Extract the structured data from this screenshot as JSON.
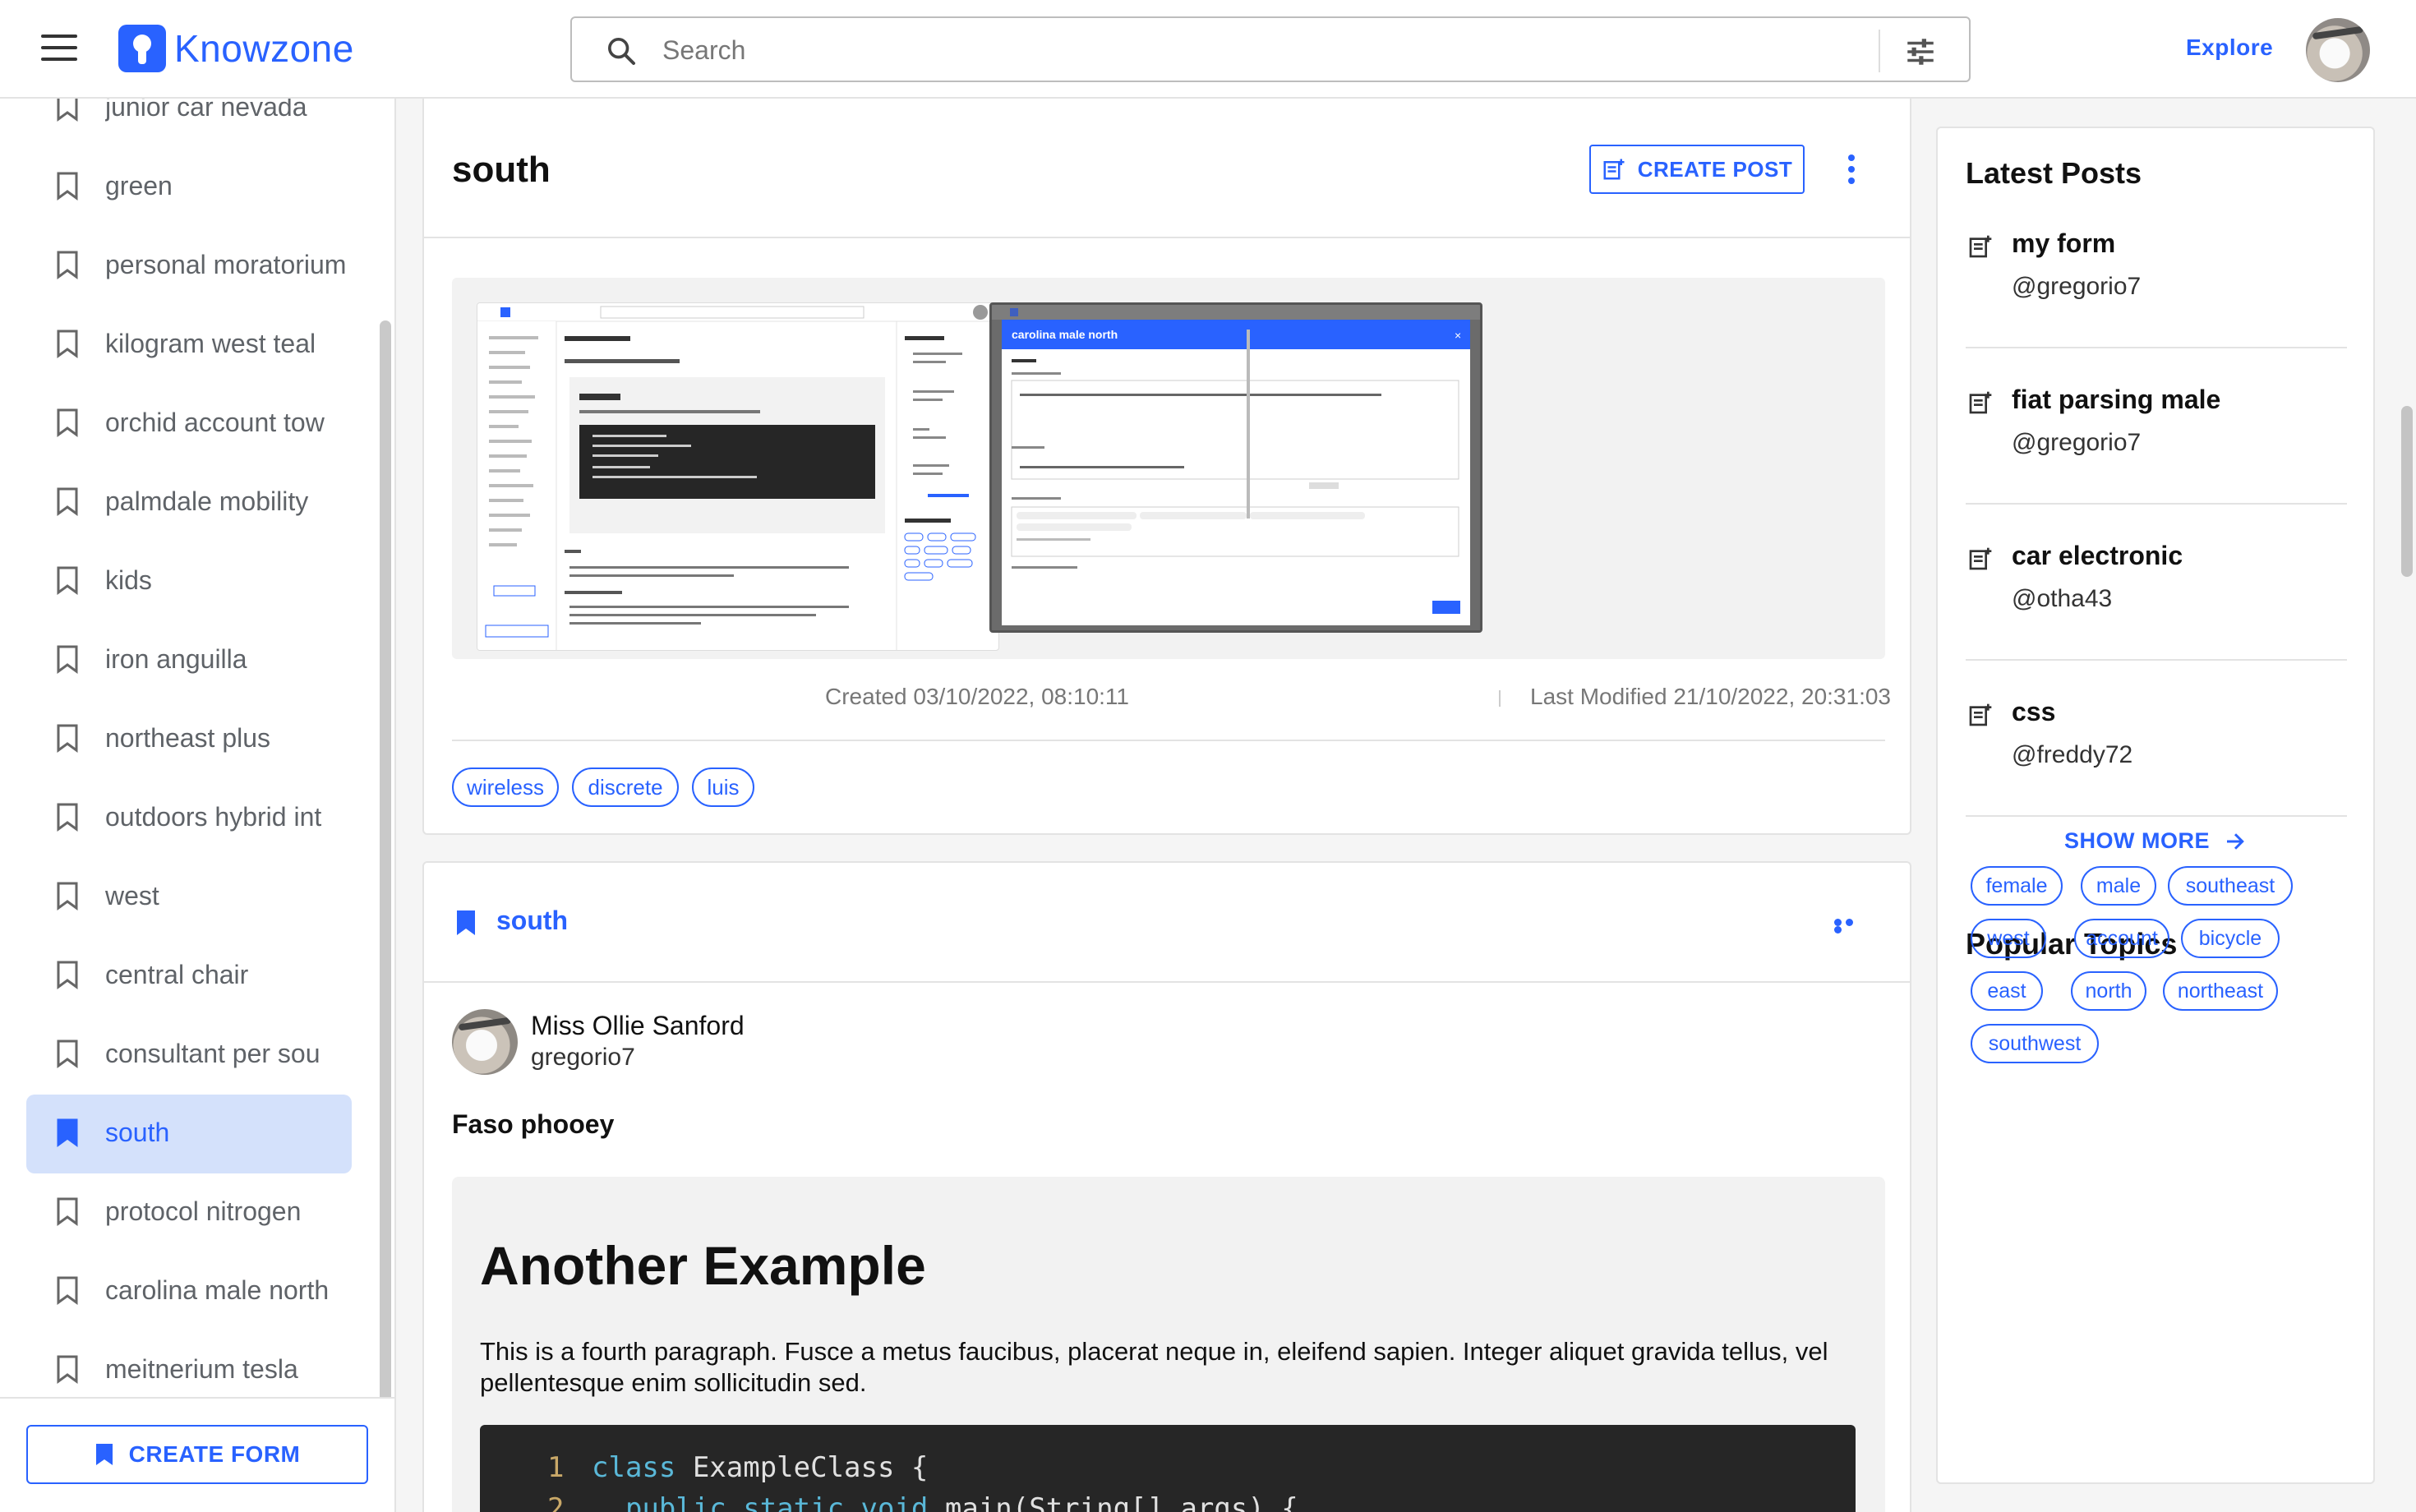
{
  "app": {
    "name": "Knowzone"
  },
  "search": {
    "placeholder": "Search"
  },
  "header": {
    "explore_label": "Explore"
  },
  "sidebar": {
    "items": [
      {
        "label": "junior car nevada"
      },
      {
        "label": "green"
      },
      {
        "label": "personal moratorium"
      },
      {
        "label": "kilogram west teal"
      },
      {
        "label": "orchid account tow"
      },
      {
        "label": "palmdale mobility"
      },
      {
        "label": "kids"
      },
      {
        "label": "iron anguilla"
      },
      {
        "label": "northeast plus"
      },
      {
        "label": "outdoors hybrid int"
      },
      {
        "label": "west"
      },
      {
        "label": "central chair"
      },
      {
        "label": "consultant per sou"
      },
      {
        "label": "south",
        "active": true
      },
      {
        "label": "protocol nitrogen"
      },
      {
        "label": "carolina male north"
      },
      {
        "label": "meitnerium tesla"
      }
    ],
    "create_form_label": "CREATE FORM"
  },
  "topic_card": {
    "title": "south",
    "create_post_label": "CREATE POST",
    "created": "Created 03/10/2022, 08:10:11",
    "modified": "Last Modified 21/10/2022, 20:31:03",
    "tags": [
      "wireless",
      "discrete",
      "luis"
    ],
    "thumb2_title": "carolina male north"
  },
  "post": {
    "topic": "south",
    "author_name": "Miss Ollie Sanford",
    "author_handle": "gregorio7",
    "title": "Faso phooey",
    "heading": "Another Example",
    "paragraph": "This is a fourth paragraph. Fusce a metus faucibus, placerat neque in, eleifend sapien. Integer aliquet gravida tellus, vel pellentesque enim sollicitudin sed.",
    "code_lines": [
      {
        "n": "1",
        "kw": "class",
        "rest": " ExampleClass {"
      },
      {
        "n": "2",
        "kw": "  public static void",
        "rest": " main(String[] args) {"
      }
    ]
  },
  "latest_posts": {
    "title": "Latest Posts",
    "items": [
      {
        "title": "my form",
        "user": "@gregorio7"
      },
      {
        "title": "fiat parsing male",
        "user": "@gregorio7"
      },
      {
        "title": "car electronic",
        "user": "@otha43"
      },
      {
        "title": "css",
        "user": "@freddy72"
      }
    ],
    "show_more_label": "SHOW MORE"
  },
  "popular_topics": {
    "title": "Popular Topics",
    "items": [
      "female",
      "male",
      "southeast",
      "west",
      "account",
      "bicycle",
      "east",
      "north",
      "northeast",
      "southwest"
    ]
  },
  "colors": {
    "accent": "#2962ff",
    "active_bg": "#d4e1fb"
  }
}
